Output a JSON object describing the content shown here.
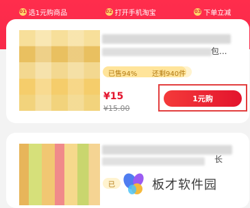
{
  "steps": [
    {
      "num": "01",
      "text": "选1元购商品"
    },
    {
      "num": "02",
      "text": "打开手机淘宝"
    },
    {
      "num": "03",
      "text": "下单立减"
    }
  ],
  "product1": {
    "title_tail": "包...",
    "progress_percent": 94,
    "sold_text": "已售94%",
    "remaining_text": "还剩940件",
    "price": "¥15",
    "original_price": "¥15.00",
    "buy_label": "1元购"
  },
  "product2": {
    "title_tail": "长",
    "badge_text": "已"
  },
  "watermark": {
    "text": "板才软件园"
  },
  "colors": {
    "brand_red": "#f8294a",
    "price_red": "#e3142d",
    "progress_bg": "#fff3cf",
    "highlight_box": "#e23c3c"
  }
}
